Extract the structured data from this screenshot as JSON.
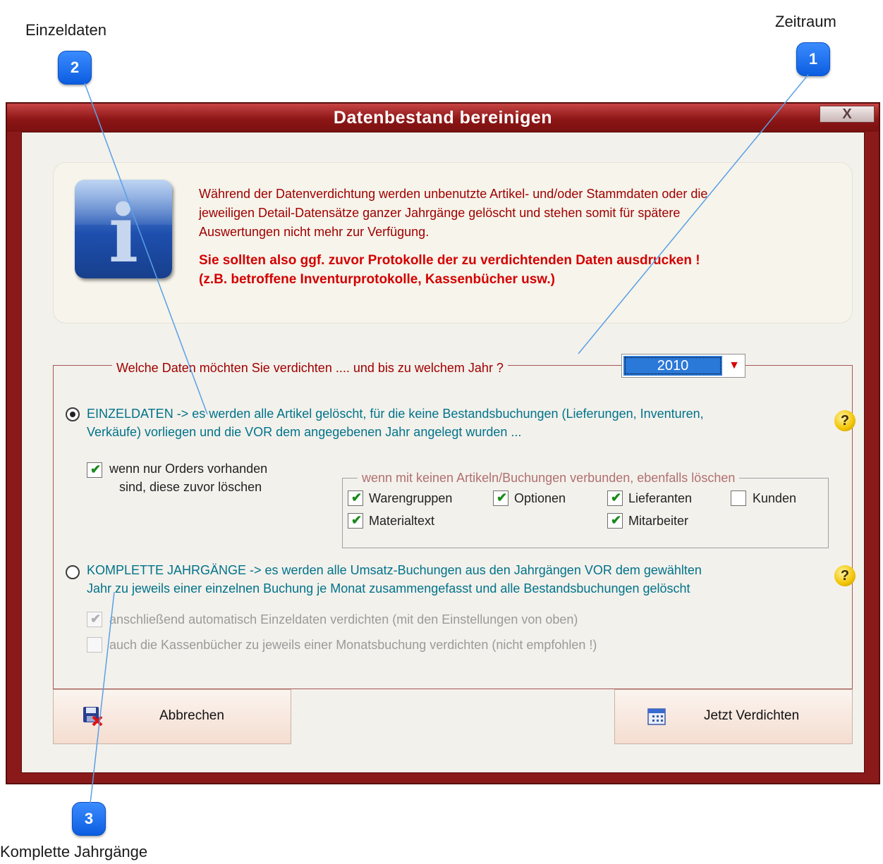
{
  "callouts": {
    "zeitraum": {
      "label": "Zeitraum",
      "number": "1"
    },
    "einzeldaten": {
      "label": "Einzeldaten",
      "number": "2"
    },
    "komplette": {
      "label": "Komplette Jahrgänge",
      "number": "3"
    }
  },
  "window": {
    "title": "Datenbestand bereinigen",
    "close_glyph": "X"
  },
  "info": {
    "icon_letter": "i",
    "text_lines": [
      "Während der Datenverdichtung werden unbenutzte Artikel- und/oder Stammdaten oder die",
      "jeweiligen Detail-Datensätze ganzer Jahrgänge gelöscht und stehen somit für spätere",
      "Auswertungen nicht mehr zur Verfügung."
    ],
    "warning_lines": [
      "Sie sollten also ggf. zuvor Protokolle der zu verdichtenden Daten ausdrucken !",
      "(z.B. betroffene Inventurprotokolle, Kassenbücher usw.)"
    ]
  },
  "group": {
    "legend": "Welche Daten möchten Sie verdichten .... und bis zu welchem Jahr ?",
    "year": "2010"
  },
  "einzeldaten": {
    "selected": true,
    "text_lines": [
      "EINZELDATEN -> es werden alle Artikel gelöscht, für die keine Bestandsbuchungen (Lieferungen, Inventuren,",
      "Verkäufe) vorliegen und  die VOR dem angegebenen Jahr angelegt wurden ..."
    ],
    "orders_checkbox": {
      "checked": true,
      "line1": "wenn nur Orders vorhanden",
      "line2": "sind, diese zuvor löschen"
    },
    "sub_legend": "wenn mit keinen Artikeln/Buchungen verbunden, ebenfalls löschen",
    "checkboxes": [
      {
        "label": "Warengruppen",
        "checked": true
      },
      {
        "label": "Optionen",
        "checked": true
      },
      {
        "label": "Lieferanten",
        "checked": true
      },
      {
        "label": "Kunden",
        "checked": false
      },
      {
        "label": "Materialtext",
        "checked": true
      },
      {
        "label": "Mitarbeiter",
        "checked": true
      }
    ]
  },
  "komplette": {
    "selected": false,
    "text_lines": [
      "KOMPLETTE JAHRGÄNGE -> es werden alle Umsatz-Buchungen aus den Jahrgängen  VOR dem gewählten",
      "Jahr zu jeweils einer einzelnen Buchung je Monat zusammengefasst und alle Bestandsbuchungen gelöscht"
    ],
    "options": [
      {
        "label": "anschließend automatisch Einzeldaten verdichten (mit den Einstellungen von oben)",
        "checked": true
      },
      {
        "label": "auch die Kassenbücher zu jeweils einer Monatsbuchung verdichten (nicht empfohlen !)",
        "checked": false
      }
    ]
  },
  "help_glyph": "?",
  "buttons": {
    "cancel": "Abbrechen",
    "compress": "Jetzt Verdichten"
  }
}
